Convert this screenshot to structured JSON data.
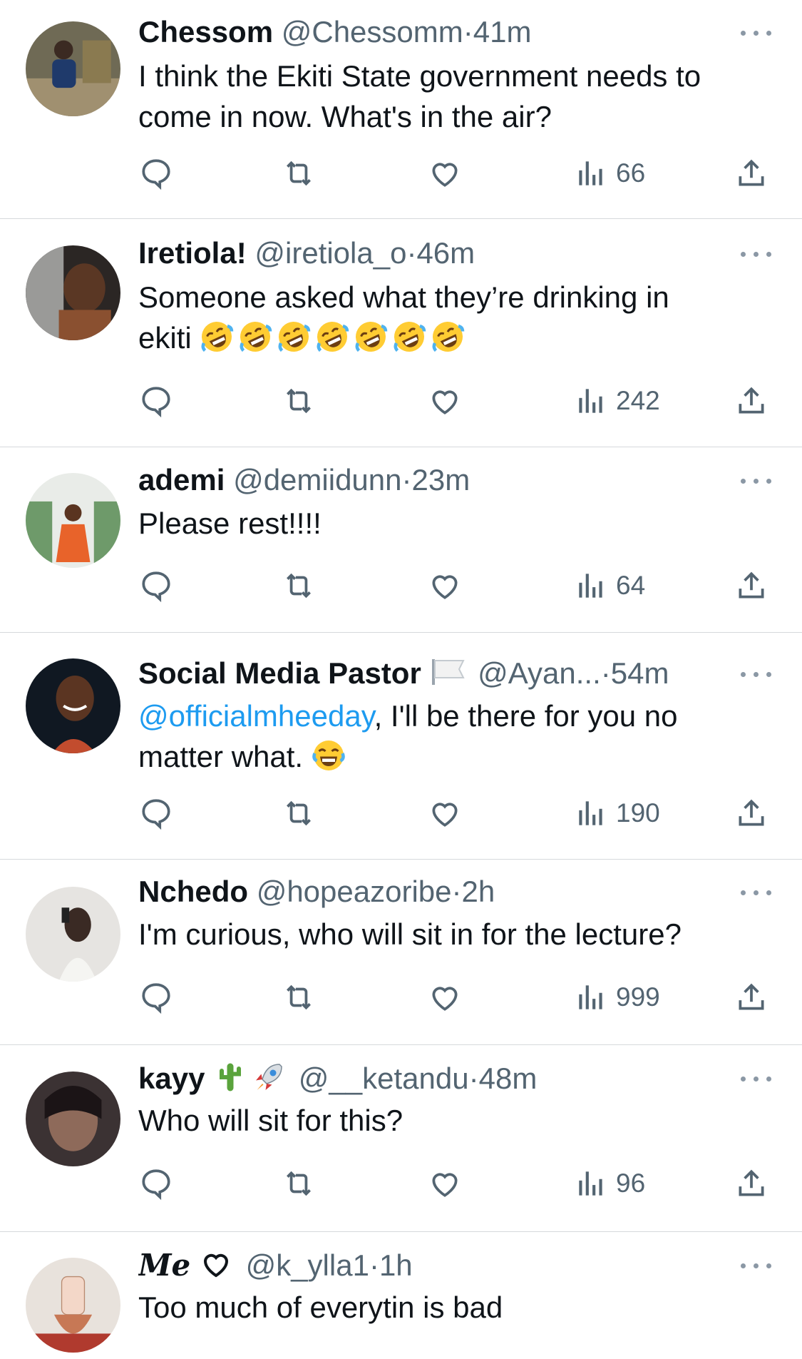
{
  "colors": {
    "text": "#0f1419",
    "muted": "#536471",
    "mention": "#1d9bf0",
    "divider": "#d6d9dc"
  },
  "icons": {
    "reply": "reply-icon",
    "retweet": "retweet-icon",
    "like": "heart-icon",
    "views": "views-icon",
    "share": "share-icon",
    "more": "more-icon"
  },
  "tweets": [
    {
      "name": "Chessom",
      "handle": "@Chessomm",
      "sep": "·",
      "time": "41m",
      "text_line1": "I think the Ekiti State government needs to",
      "text_line2": "come in now. What's in the air?",
      "views": "66"
    },
    {
      "name": "Iretiola!",
      "handle": "@iretiola_o",
      "sep": "·",
      "time": "46m",
      "text_line1": "Someone asked what they’re drinking in",
      "text_line2": "ekiti",
      "emoji": "rolling-on-floor-laughing",
      "emoji_count": 7,
      "views": "242"
    },
    {
      "name": "ademi",
      "handle": "@demiidunn",
      "sep": "·",
      "time": "23m",
      "text_line1": "Please rest!!!!",
      "views": "64"
    },
    {
      "name": "Social Media Pastor",
      "handle": "@Ayan...",
      "sep": "·",
      "time": "54m",
      "mention": "@officialmheeday",
      "text_line1": ", I'll be there for you no",
      "text_line2": "matter what.",
      "emoji": "face-with-tears-of-joy",
      "views": "190"
    },
    {
      "name": "Nchedo",
      "handle": "@hopeazoribe",
      "sep": "·",
      "time": "2h",
      "text_line1": "I'm curious, who will sit in for the lecture?",
      "views": "999"
    },
    {
      "name": "kayy",
      "handle": "@__ketandu",
      "sep": "·",
      "time": "48m",
      "text_line1": "Who will sit for this?",
      "views": "96"
    },
    {
      "name": "Me",
      "handle": "@k_ylla1",
      "sep": "·",
      "time": "1h",
      "text_line1": "Too much of everytin is bad"
    }
  ]
}
